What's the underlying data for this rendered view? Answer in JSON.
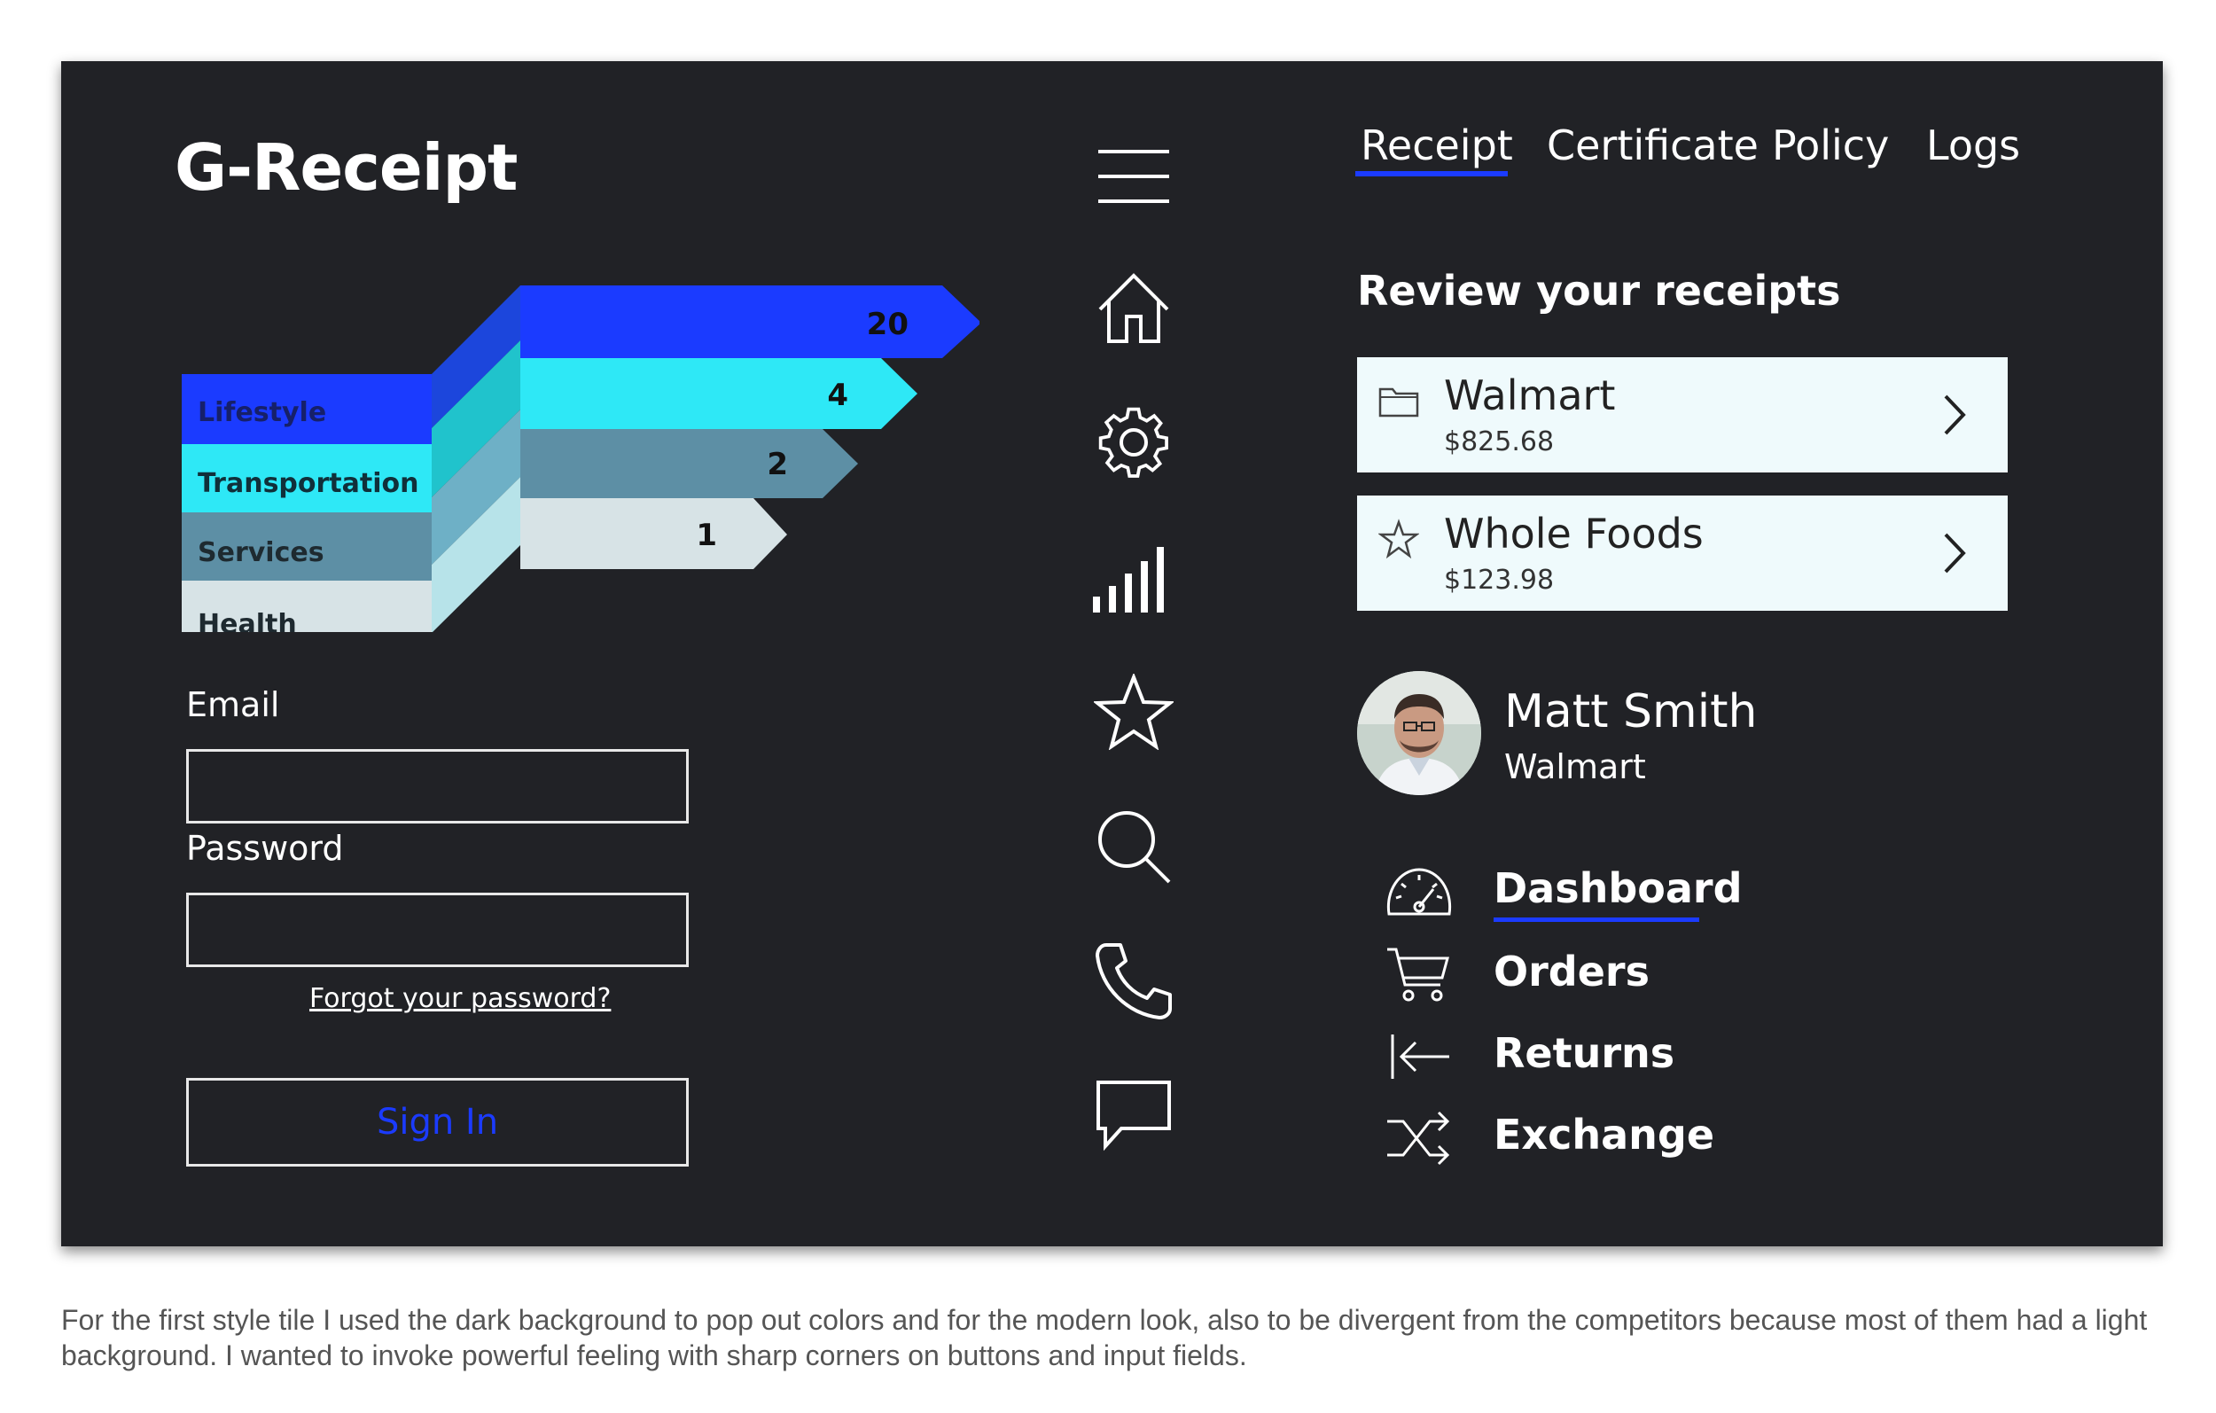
{
  "app": {
    "title": "G-Receipt"
  },
  "categories": [
    {
      "label": "Lifestyle",
      "value": "20",
      "color": "#1b3bff"
    },
    {
      "label": "Transportation",
      "value": "4",
      "color": "#2ee8f6"
    },
    {
      "label": "Services",
      "value": "2",
      "color": "#5d8fa5"
    },
    {
      "label": "Health",
      "value": "1",
      "color": "#d7e3e6"
    }
  ],
  "login": {
    "email_label": "Email",
    "email_value": "",
    "password_label": "Password",
    "password_value": "",
    "forgot_link": "Forgot your password?",
    "signin_button": "Sign In"
  },
  "sidebar": {
    "icons": [
      "menu-icon",
      "home-icon",
      "gear-icon",
      "signal-bars-icon",
      "star-icon",
      "search-icon",
      "phone-icon",
      "chat-icon"
    ]
  },
  "tabs": {
    "active": "Receipt",
    "items": [
      "Receipt",
      "Certificate",
      "Policy",
      "Logs"
    ]
  },
  "receipts": {
    "title": "Review your receipts",
    "items": [
      {
        "icon": "folder-icon",
        "name": "Walmart",
        "amount": "$825.68"
      },
      {
        "icon": "star-outline-icon",
        "name": "Whole Foods",
        "amount": "$123.98"
      }
    ]
  },
  "user": {
    "name": "Matt Smith",
    "store": "Walmart"
  },
  "menu": {
    "active": "Dashboard",
    "items": [
      {
        "icon": "speedometer-icon",
        "label": "Dashboard"
      },
      {
        "icon": "cart-icon",
        "label": "Orders"
      },
      {
        "icon": "return-arrow-icon",
        "label": "Returns"
      },
      {
        "icon": "shuffle-icon",
        "label": "Exchange"
      }
    ]
  },
  "caption": "For the first style tile I used the dark background to pop out colors and for the modern look, also to be divergent from the competitors because most of them had a light background. I wanted to invoke powerful feeling with sharp corners on buttons and input fields.",
  "colors": {
    "background": "#212226",
    "accent": "#1b3bff",
    "card": "#effafc",
    "text": "#ffffff"
  }
}
